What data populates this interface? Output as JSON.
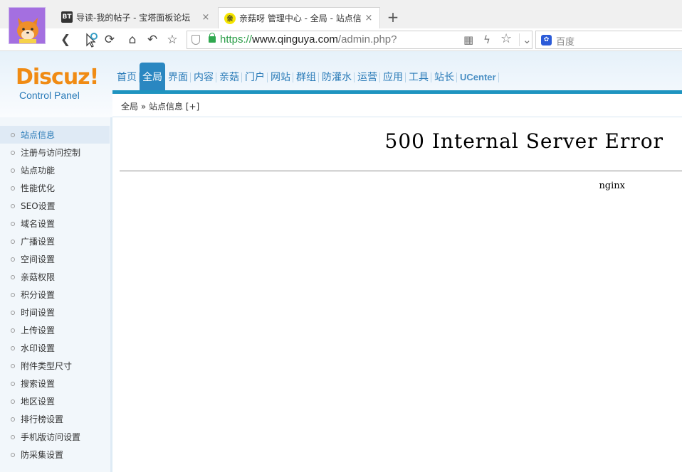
{
  "browser": {
    "tabs": [
      {
        "favicon": "BT",
        "title": "导读-我的帖子 - 宝塔面板论坛",
        "close": "×"
      },
      {
        "favicon": "亲",
        "title": "亲菇呀 管理中心 - 全局 - 站点信",
        "close": "×"
      }
    ],
    "new_tab": "+",
    "url": {
      "scheme": "https://",
      "host": "www.qinguya.com",
      "path": "/admin.php?"
    },
    "search_placeholder": "百度"
  },
  "admin": {
    "logo_title": "Discuz!",
    "logo_subtitle": "Control Panel",
    "nav": [
      "首页",
      "全局",
      "界面",
      "内容",
      "亲菇",
      "门户",
      "网站",
      "群组",
      "防灌水",
      "运营",
      "应用",
      "工具",
      "站长",
      "UCenter"
    ],
    "active_nav_index": 1,
    "breadcrumb": "全局 » 站点信息 [+]",
    "sidebar": [
      "站点信息",
      "注册与访问控制",
      "站点功能",
      "性能优化",
      "SEO设置",
      "域名设置",
      "广播设置",
      "空间设置",
      "亲菇权限",
      "积分设置",
      "时间设置",
      "上传设置",
      "水印设置",
      "附件类型尺寸",
      "搜索设置",
      "地区设置",
      "排行榜设置",
      "手机版访问设置",
      "防采集设置"
    ],
    "active_sidebar_index": 0
  },
  "error": {
    "title": "500 Internal Server Error",
    "server": "nginx"
  },
  "colors": {
    "accent": "#2a87c1",
    "logo_orange": "#f08b14",
    "url_green": "#2a9d47"
  }
}
